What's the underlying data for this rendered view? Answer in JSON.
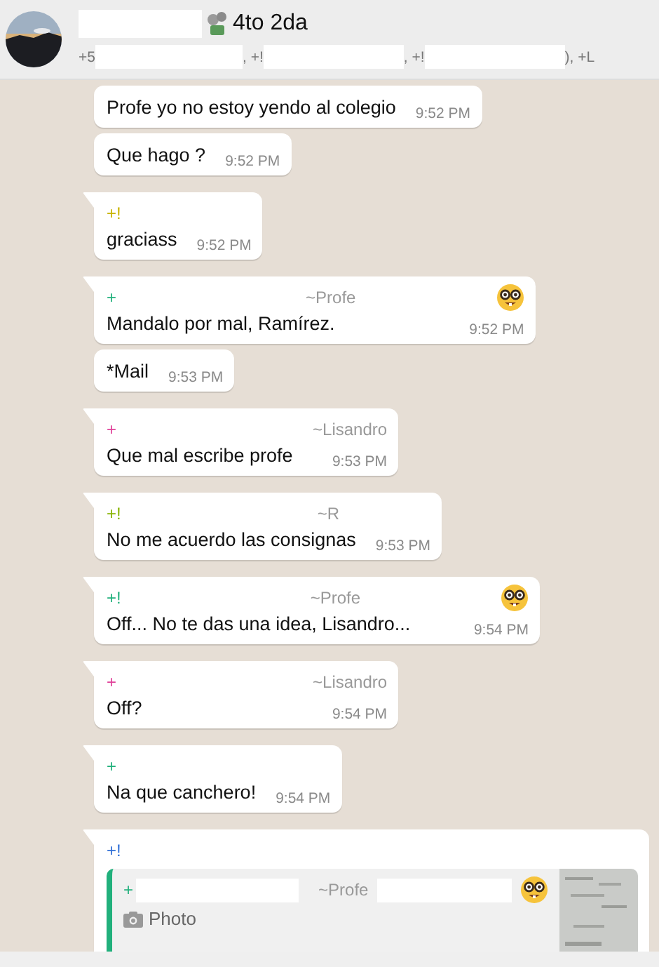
{
  "header": {
    "title": "4to 2da",
    "participants": [
      "+5",
      ", +!",
      ", +!",
      "), +L"
    ]
  },
  "messages": [
    {
      "kind": "text",
      "tail": false,
      "text": "Profe yo no estoy yendo al colegio",
      "time": "9:52 PM"
    },
    {
      "kind": "text",
      "tail": false,
      "text": "Que hago ?",
      "time": "9:52 PM"
    },
    {
      "kind": "text",
      "tail": true,
      "sender": {
        "phone": "+!",
        "color": "#c8b400"
      },
      "text": "graciass",
      "time": "9:52 PM"
    },
    {
      "kind": "text",
      "tail": true,
      "sender": {
        "phone": "+",
        "name": "~Profe",
        "color": "#21b07c",
        "emoji": true
      },
      "text": "Mandalo por mal, Ramírez.",
      "time": "9:52 PM"
    },
    {
      "kind": "text",
      "tail": false,
      "text": "*Mail",
      "time": "9:53 PM"
    },
    {
      "kind": "text",
      "tail": true,
      "sender": {
        "phone": "+",
        "name": "~Lisandro",
        "color": "#e0439a",
        "emoji": false
      },
      "text": "Que mal escribe profe",
      "time": "9:53 PM"
    },
    {
      "kind": "text",
      "tail": true,
      "sender": {
        "phone": "+!",
        "name": "~R",
        "color": "#86b300",
        "emoji": false
      },
      "text": "No me acuerdo las consignas",
      "time": "9:53 PM"
    },
    {
      "kind": "text",
      "tail": true,
      "sender": {
        "phone": "+!",
        "name": "~Profe",
        "color": "#21b07c",
        "emoji": true
      },
      "text": "Off... No te das una idea, Lisandro...",
      "time": "9:54 PM"
    },
    {
      "kind": "text",
      "tail": true,
      "sender": {
        "phone": "+",
        "name": "~Lisandro",
        "color": "#e0439a",
        "emoji": false
      },
      "text": "Off?",
      "time": "9:54 PM"
    },
    {
      "kind": "text",
      "tail": true,
      "sender": {
        "phone": "+",
        "color": "#21b07c"
      },
      "text": "Na que canchero!",
      "time": "9:54 PM"
    },
    {
      "kind": "photo_reply",
      "tail": true,
      "sender": {
        "phone": "+!",
        "color": "#2f6fd6"
      },
      "quote": {
        "phone": "+",
        "name": "~Profe",
        "color": "#21b07c",
        "emoji": true,
        "label": "Photo"
      }
    }
  ]
}
